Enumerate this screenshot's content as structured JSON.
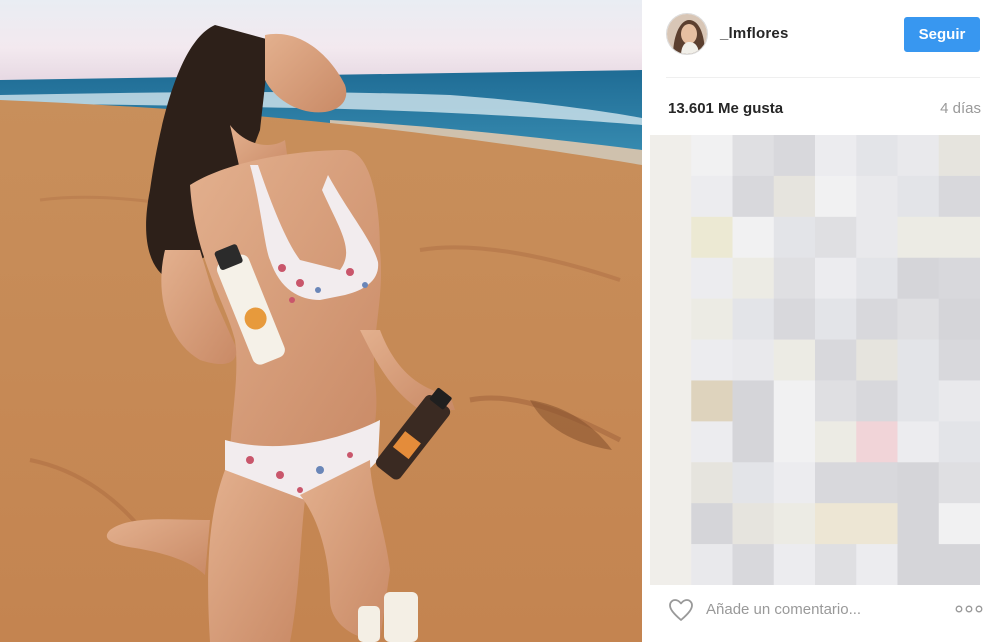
{
  "post": {
    "username": "_lmflores",
    "follow_label": "Seguir",
    "likes_text": "13.601 Me gusta",
    "age": "4 días",
    "comment_placeholder": "Añade un comentario...",
    "icons": {
      "like": "heart-icon",
      "more": "more-options-icon",
      "avatar": "avatar"
    }
  },
  "colors": {
    "accent": "#3897f0",
    "text": "#262626",
    "muted": "#999999"
  }
}
